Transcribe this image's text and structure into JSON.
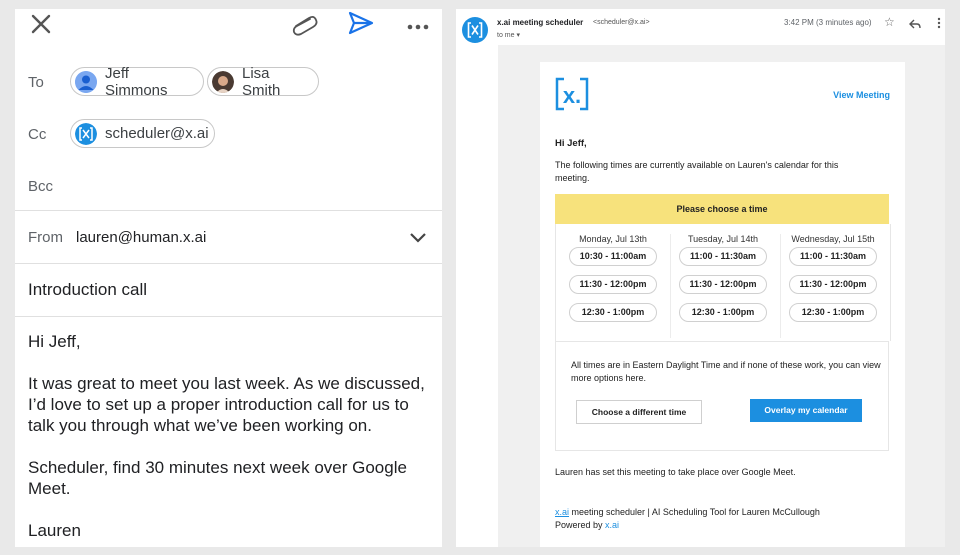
{
  "compose": {
    "to_label": "To",
    "to_recipients": [
      "Jeff Simmons",
      "Lisa Smith"
    ],
    "cc_label": "Cc",
    "cc_recipient": "scheduler@x.ai",
    "bcc_label": "Bcc",
    "from_label": "From",
    "from_value": "lauren@human.x.ai",
    "subject": "Introduction call",
    "body": [
      "Hi Jeff,",
      "It was great to meet you last week. As we discussed, I’d love to set up a proper introduction call for us to talk you through what we’ve been working on.",
      "Scheduler, find 30 minutes next week over Google Meet.",
      "Lauren"
    ],
    "icons": [
      "close-icon",
      "attach-icon",
      "send-icon",
      "more-icon"
    ]
  },
  "email": {
    "sender_name": "x.ai meeting scheduler",
    "sender_email": "<scheduler@x.ai>",
    "to_line": "to me",
    "timestamp": "3:42 PM (3 minutes ago)",
    "icons": [
      "star-icon",
      "reply-icon",
      "more-vert-icon"
    ],
    "logo_text": "x.",
    "view_meeting": "View Meeting",
    "greeting": "Hi Jeff,",
    "intro": "The following times are currently available on Lauren's calendar for this meeting.",
    "banner": "Please choose a time",
    "days": [
      {
        "day": "Monday, Jul 13th",
        "slots": [
          "10:30 - 11:00am",
          "11:30 - 12:00pm",
          "12:30 - 1:00pm"
        ]
      },
      {
        "day": "Tuesday, Jul 14th",
        "slots": [
          "11:00 - 11:30am",
          "11:30 - 12:00pm",
          "12:30 - 1:00pm"
        ]
      },
      {
        "day": "Wednesday, Jul 15th",
        "slots": [
          "11:00 - 11:30am",
          "11:30 - 12:00pm",
          "12:30 - 1:00pm"
        ]
      }
    ],
    "timezone_note": "All times are in Eastern Daylight Time and if none of these work, you can view more options here.",
    "btn_different": "Choose a different time",
    "btn_overlay": "Overlay my calendar",
    "meet_note": "Lauren has set this meeting to take place over Google Meet.",
    "footer_link": "x.ai",
    "footer_text": " meeting scheduler | AI Scheduling Tool for Lauren McCullough",
    "powered_by": "Powered by ",
    "powered_link": "x.ai"
  },
  "colors": {
    "accent": "#1c8fe0",
    "banner": "#f7e27c",
    "send": "#1a73e8"
  }
}
